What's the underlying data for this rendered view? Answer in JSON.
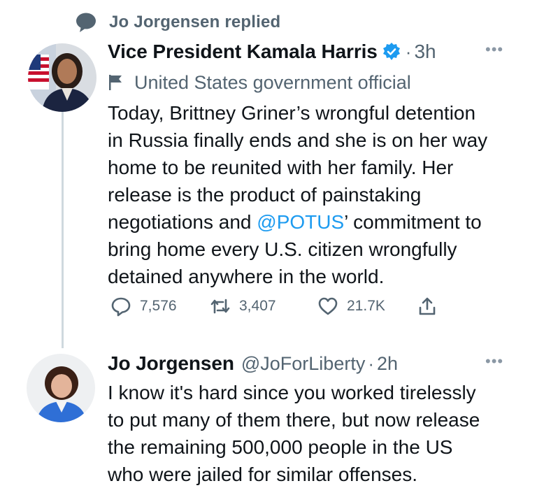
{
  "context": {
    "label": "Jo Jorgensen replied",
    "icon": "speech-bubble-icon"
  },
  "tweets": [
    {
      "name": "Vice President Kamala Harris",
      "verified": true,
      "time": "3h",
      "label": "United States government official",
      "text_before": "Today, Brittney Griner’s wrongful detention\nin Russia finally ends and she is on her way\nhome to be reunited with her family. Her\nrelease is the product of painstaking\nnegotiations and ",
      "mention": "@POTUS",
      "text_after": "’ commitment to\nbring home every U.S. citizen wrongfully\ndetained anywhere in the world.",
      "replies": "7,576",
      "retweets": "3,407",
      "likes": "21.7K"
    },
    {
      "name": "Jo Jorgensen",
      "handle": "@JoForLiberty",
      "time": "2h",
      "text": "I know it's hard since you worked tirelessly\nto put many of them there, but now release\nthe remaining 500,000 people in the US\nwho were jailed for similar offenses."
    }
  ],
  "colors": {
    "accent": "#1d9bf0",
    "muted": "#536471",
    "text": "#0f1419",
    "line": "#cfd9de"
  }
}
